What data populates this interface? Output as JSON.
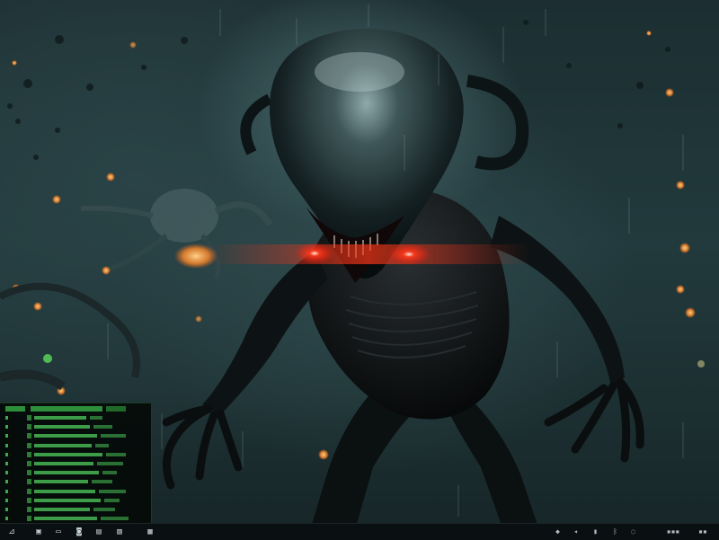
{
  "desktop": {
    "wallpaper": "alien-creature-wallpaper",
    "colors": {
      "background": "#1c2e31",
      "eye_glow": "#ff2a1a",
      "terminal_text": "#46b653",
      "bokeh": "#ff8a2a"
    }
  },
  "terminal": {
    "lines": 13
  },
  "taskbar": {
    "start_icon": "start-menu-icon",
    "apps": [
      "file-manager-icon",
      "terminal-icon",
      "browser-icon",
      "media-icon",
      "image-viewer-icon",
      "settings-icon"
    ],
    "tray": [
      "network-icon",
      "volume-icon",
      "battery-icon",
      "bluetooth-icon",
      "notification-icon"
    ]
  }
}
